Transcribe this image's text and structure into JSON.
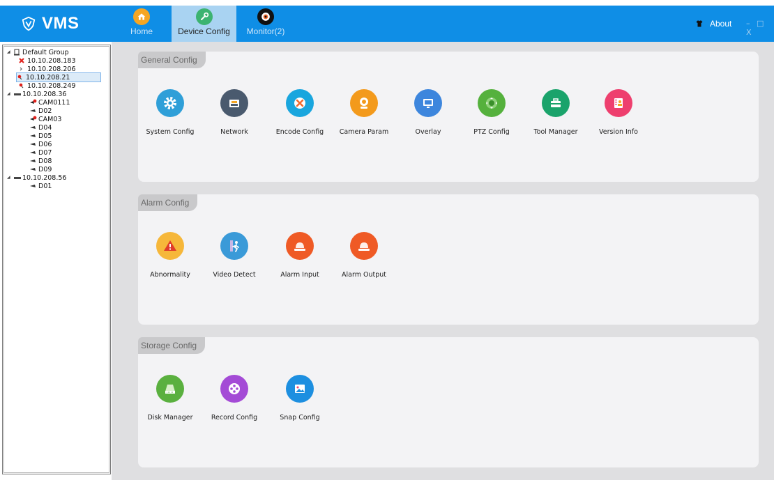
{
  "app": {
    "title": "VMS"
  },
  "tabs": [
    {
      "label": "Home",
      "icon": "home-icon"
    },
    {
      "label": "Device Config",
      "icon": "wrench-icon"
    },
    {
      "label": "Monitor(2)",
      "icon": "camera-lens-icon"
    }
  ],
  "header": {
    "about_label": "About",
    "window_controls": "– □ X"
  },
  "tree": {
    "nodes": [
      {
        "label": "Default Group",
        "icon": "group-icon"
      },
      {
        "label": "10.10.208.183",
        "icon": "device-offline-icon"
      },
      {
        "label": "10.10.208.206",
        "icon": "device-icon"
      },
      {
        "label": "10.10.208.21",
        "icon": "device-online-icon"
      },
      {
        "label": "10.10.208.249",
        "icon": "device-online-icon"
      },
      {
        "label": "10.10.208.36",
        "icon": "nvr-icon"
      },
      {
        "label": "CAM0111",
        "icon": "camera-recording-icon"
      },
      {
        "label": "D02",
        "icon": "camera-icon"
      },
      {
        "label": "CAM03",
        "icon": "camera-recording-icon"
      },
      {
        "label": "D04",
        "icon": "camera-icon"
      },
      {
        "label": "D05",
        "icon": "camera-icon"
      },
      {
        "label": "D06",
        "icon": "camera-icon"
      },
      {
        "label": "D07",
        "icon": "camera-icon"
      },
      {
        "label": "D08",
        "icon": "camera-icon"
      },
      {
        "label": "D09",
        "icon": "camera-icon"
      },
      {
        "label": "10.10.208.56",
        "icon": "nvr-icon"
      },
      {
        "label": "D01",
        "icon": "camera-icon"
      }
    ],
    "selected": "10.10.208.21"
  },
  "sections": {
    "general": {
      "title": "General Config",
      "items": [
        {
          "label": "System Config",
          "icon": "gear-icon",
          "color": "#2f9fd8"
        },
        {
          "label": "Network",
          "icon": "network-port-icon",
          "color": "#4a5a6e"
        },
        {
          "label": "Encode Config",
          "icon": "tools-icon",
          "color": "#19a6de"
        },
        {
          "label": "Camera Param",
          "icon": "webcam-icon",
          "color": "#f39a1c"
        },
        {
          "label": "Overlay",
          "icon": "monitor-icon",
          "color": "#3d86dd"
        },
        {
          "label": "PTZ Config",
          "icon": "ptz-joystick-icon",
          "color": "#55b13d"
        },
        {
          "label": "Tool Manager",
          "icon": "toolbox-icon",
          "color": "#1aa36b"
        },
        {
          "label": "Version Info",
          "icon": "contact-book-icon",
          "color": "#ee3f6e"
        }
      ]
    },
    "alarm": {
      "title": "Alarm Config",
      "items": [
        {
          "label": "Abnormality",
          "icon": "warning-icon",
          "color": "#f6b73a"
        },
        {
          "label": "Video Detect",
          "icon": "motion-detect-icon",
          "color": "#3a9ad8"
        },
        {
          "label": "Alarm Input",
          "icon": "alarm-light-icon",
          "color": "#ef5a25"
        },
        {
          "label": "Alarm Output",
          "icon": "alarm-light-icon",
          "color": "#ef5a25"
        }
      ]
    },
    "storage": {
      "title": "Storage Config",
      "items": [
        {
          "label": "Disk Manager",
          "icon": "hard-disk-icon",
          "color": "#5ab03f"
        },
        {
          "label": "Record Config",
          "icon": "film-reel-icon",
          "color": "#a44bd6"
        },
        {
          "label": "Snap Config",
          "icon": "picture-icon",
          "color": "#1d8fe0"
        }
      ]
    }
  },
  "colors": {
    "titlebar": "#0f8ee6",
    "active_tab": "#a9d3f2",
    "panel": "#f3f3f5",
    "background": "#dfdfe1"
  }
}
